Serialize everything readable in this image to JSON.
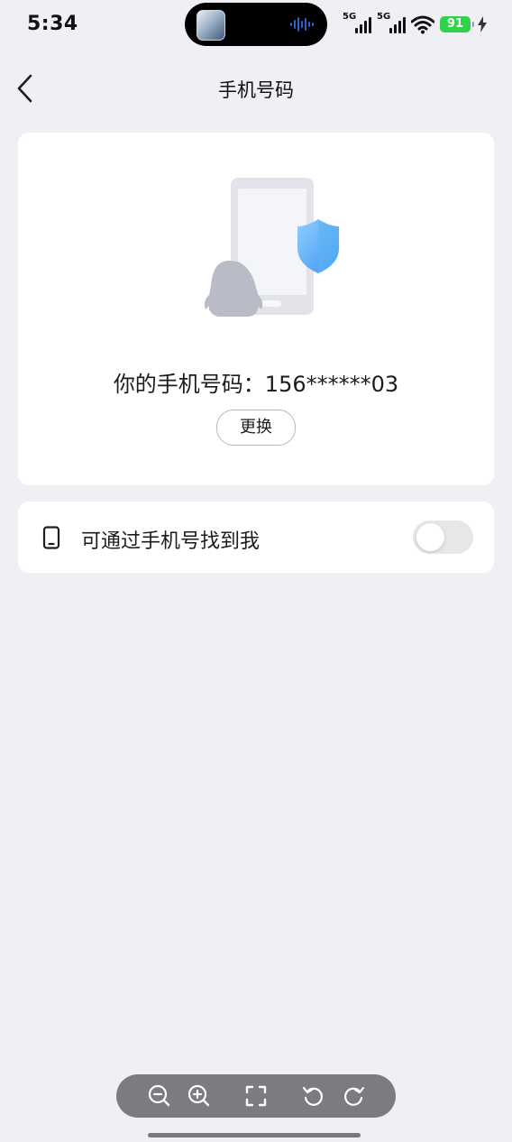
{
  "status_bar": {
    "time": "5:34",
    "signal_1_label": "5G",
    "signal_2_label": "5G",
    "battery_level": "91",
    "wifi_icon": "wifi-icon",
    "charging_icon": "charging-bolt-icon"
  },
  "nav": {
    "title": "手机号码",
    "back_icon": "chevron-left-icon"
  },
  "phone_card": {
    "illustration_icon": "phone-shield-penguin-illustration",
    "phone_number_text": "你的手机号码：156******03",
    "change_label": "更换"
  },
  "find_me": {
    "icon": "phone-icon",
    "label": "可通过手机号找到我",
    "toggle_on": false
  },
  "viewer_toolbar": {
    "buttons": [
      "zoom-out-icon",
      "zoom-in-icon",
      "fullscreen-icon",
      "rotate-left-icon",
      "rotate-right-icon"
    ]
  },
  "colors": {
    "background": "#efeff4",
    "card": "#ffffff",
    "battery": "#2fd24b",
    "shield_blue": "#4aa8f5",
    "toggle_off": "#e7e7ea"
  }
}
